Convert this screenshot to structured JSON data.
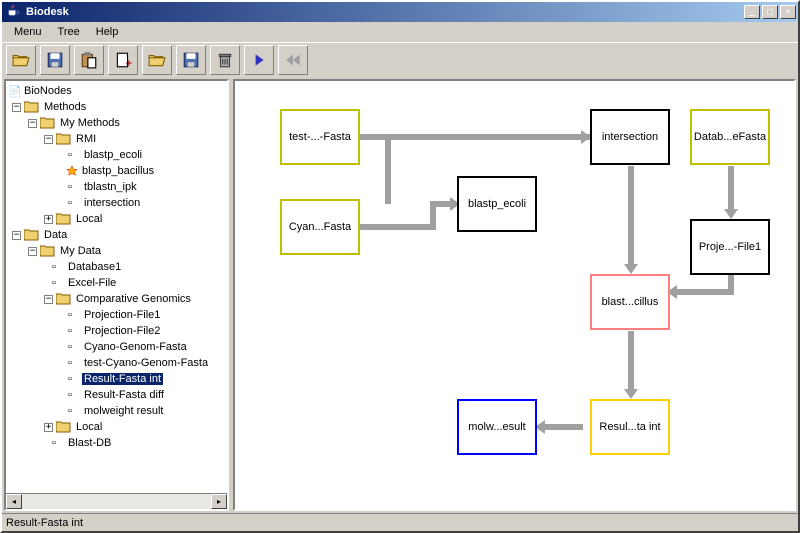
{
  "window": {
    "title": "Biodesk"
  },
  "menubar": [
    "Menu",
    "Tree",
    "Help"
  ],
  "toolbar_buttons": [
    "open",
    "save",
    "paste",
    "new-page",
    "open2",
    "save2",
    "delete",
    "play",
    "rewind"
  ],
  "tree": {
    "root": "BioNodes",
    "methods": {
      "label": "Methods",
      "my_methods": {
        "label": "My Methods",
        "rmi": {
          "label": "RMI",
          "items": [
            "blastp_ecoli",
            "blastp_bacillus",
            "tblastn_ipk",
            "intersection"
          ]
        },
        "local": "Local"
      }
    },
    "data": {
      "label": "Data",
      "my_data": {
        "label": "My Data",
        "items": [
          "Database1",
          "Excel-File"
        ],
        "comp_gen": {
          "label": "Comparative Genomics",
          "items": [
            "Projection-File1",
            "Projection-File2",
            "Cyano-Genom-Fasta",
            "test-Cyano-Genom-Fasta",
            "Result-Fasta int",
            "Result-Fasta diff",
            "molweight result"
          ]
        },
        "local": "Local",
        "blast_db": "Blast-DB"
      }
    }
  },
  "selected_tree_item": "Result-Fasta int",
  "canvas": {
    "nodes": {
      "test_fasta": {
        "label": "test-...-Fasta",
        "color": "#c0c000"
      },
      "cyan_fasta": {
        "label": "Cyan...Fasta",
        "color": "#c0c000"
      },
      "blastp_ecoli": {
        "label": "blastp_ecoli",
        "color": "#000000"
      },
      "intersection": {
        "label": "intersection",
        "color": "#000000"
      },
      "datab_fasta": {
        "label": "Datab...eFasta",
        "color": "#c0c000"
      },
      "blast_cillus": {
        "label": "blast...cillus",
        "color": "#ff8080"
      },
      "proje_file1": {
        "label": "Proje...-File1",
        "color": "#000000"
      },
      "resul_ta_int": {
        "label": "Resul...ta int",
        "color": "#ffd000"
      },
      "molw_esult": {
        "label": "molw...esult",
        "color": "#0000ff"
      }
    }
  },
  "statusbar": {
    "text": "Result-Fasta int"
  }
}
